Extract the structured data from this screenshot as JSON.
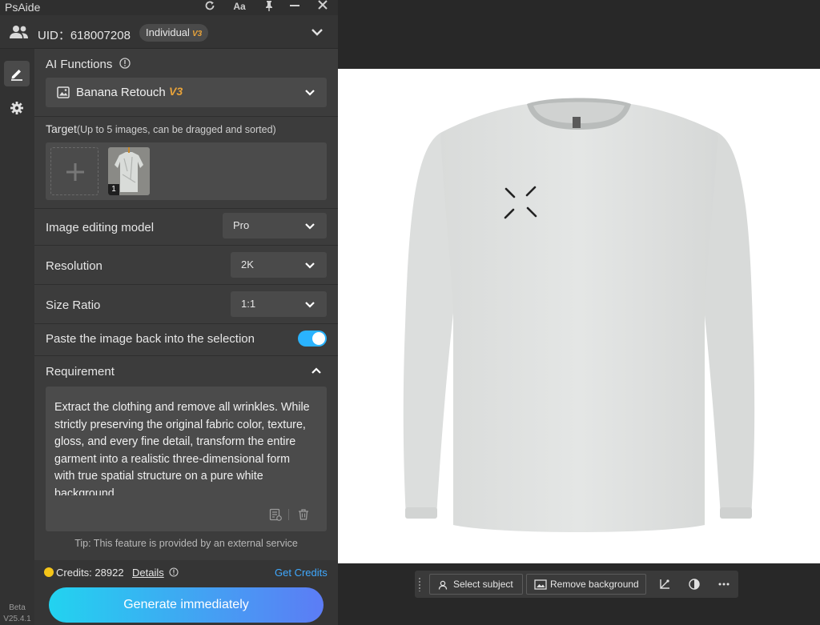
{
  "window": {
    "title": "PsAide"
  },
  "account": {
    "uid_label": "UID：618007208",
    "plan": "Individual",
    "plan_version": "V3"
  },
  "nav": {
    "version_label": "Beta",
    "version_number": "V25.4.1"
  },
  "ai_functions": {
    "label": "AI Functions",
    "selected": "Banana Retouch",
    "selected_badge": "V3"
  },
  "target": {
    "label": "Target",
    "hint": "(Up to 5 images, can be dragged and sorted)",
    "thumb_index": "1"
  },
  "model": {
    "label": "Image editing model",
    "value": "Pro"
  },
  "resolution": {
    "label": "Resolution",
    "value": "2K"
  },
  "size_ratio": {
    "label": "Size Ratio",
    "value": "1:1"
  },
  "paste_back": {
    "label": "Paste the image back into the selection",
    "enabled": true
  },
  "requirement": {
    "label": "Requirement",
    "text": "Extract the clothing and remove all wrinkles. While strictly preserving the original fabric color, texture, gloss, and every fine detail, transform the entire garment into a realistic three-dimensional form with true spatial structure on a pure white background."
  },
  "tip": "Tip: This feature is provided by an external service",
  "credits": {
    "label": "Credits: 28922",
    "details": "Details",
    "get_credits": "Get Credits"
  },
  "generate_label": "Generate immediately",
  "context_toolbar": {
    "select_subject": "Select subject",
    "remove_background": "Remove background"
  },
  "colors": {
    "accent": "#2ab3ff",
    "badge": "#e8a33a",
    "generate_start": "#22d3f0",
    "generate_end": "#5c7cf5",
    "panel": "#3c3c3c"
  }
}
